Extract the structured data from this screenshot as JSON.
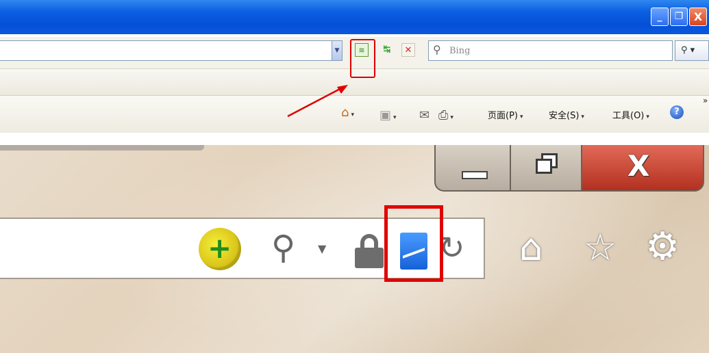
{
  "xp": {
    "window_controls": {
      "minimize": "_",
      "restore": "❐",
      "close": "X"
    },
    "search_placeholder": "Bing",
    "search_icon": "magnifier-icon",
    "compat_icon": "compatibility-view-icon",
    "refresh_icon": "refresh-icon",
    "stop_icon": "stop-icon",
    "command_bar": {
      "page_label": "页面(P)",
      "safety_label": "安全(S)",
      "tools_label": "工具(O)",
      "help_label": "?",
      "more_label": "»"
    }
  },
  "w7": {
    "window_controls": {
      "close": "X"
    },
    "icons": [
      "360-plus-icon",
      "search-icon",
      "lock-icon",
      "compatibility-view-icon",
      "refresh-icon",
      "home-icon",
      "favorites-star-icon",
      "gear-icon"
    ]
  },
  "colors": {
    "highlight": "#e00000",
    "xp_title": "#0a5fe0",
    "w7_background": "#e4d3bd"
  }
}
